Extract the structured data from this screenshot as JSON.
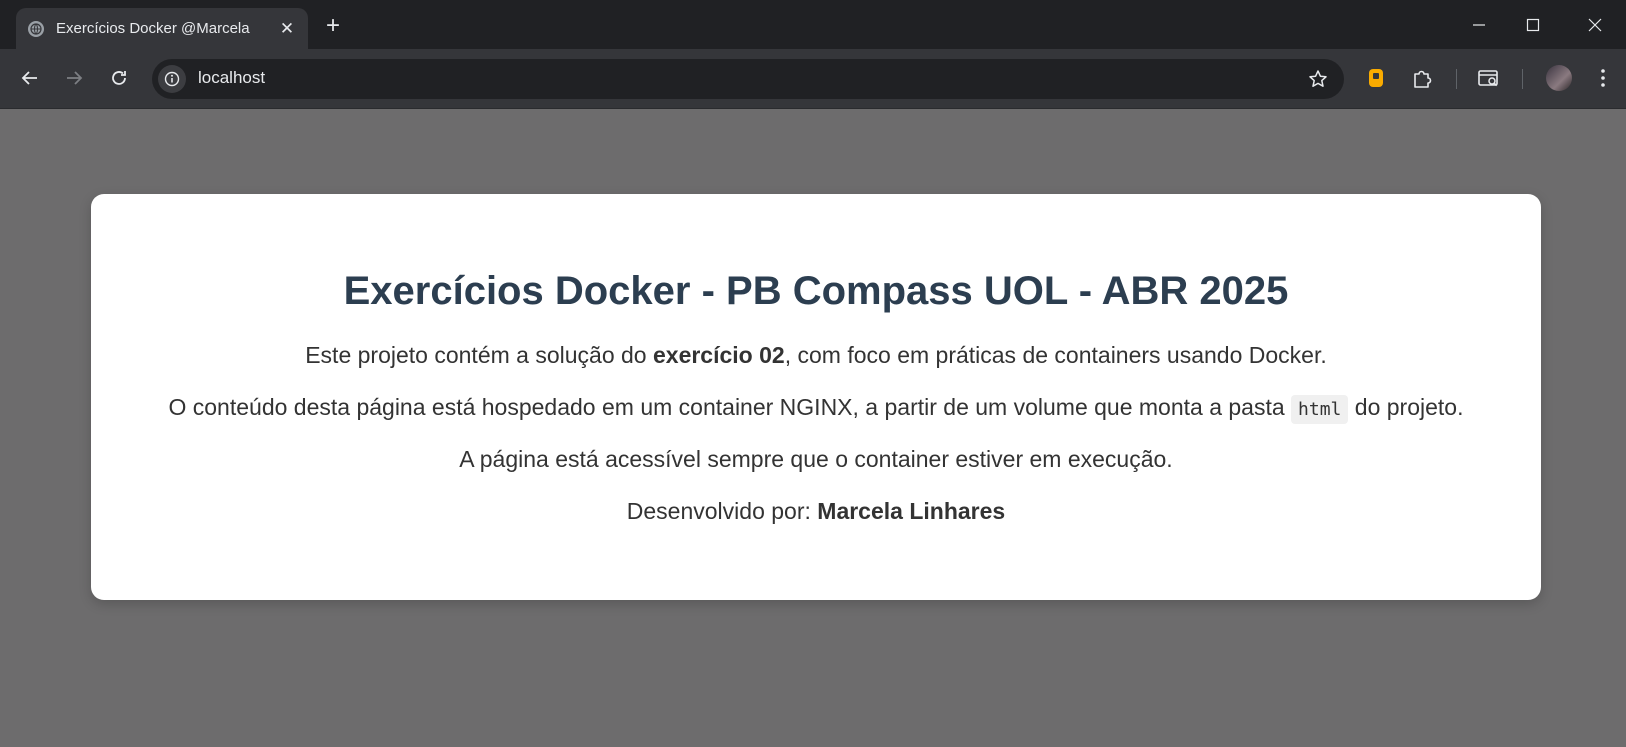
{
  "browser": {
    "tab_title": "Exercícios Docker @Marcela",
    "tab_close": "✕",
    "new_tab": "+",
    "url": "localhost",
    "window_controls": {
      "minimize": "minimize-icon",
      "maximize": "maximize-icon",
      "close": "close-icon"
    },
    "accent_color": "#f9ab00"
  },
  "page": {
    "title": "Exercícios Docker - PB Compass UOL - ABR 2025",
    "p1_pre": "Este projeto contém a solução do ",
    "p1_bold": "exercício 02",
    "p1_post": ", com foco em práticas de containers usando Docker.",
    "p2_pre": "O conteúdo desta página está hospedado em um container NGINX, a partir de um volume que monta a pasta ",
    "p2_code": "html",
    "p2_post": " do projeto.",
    "p3": "A página está acessível sempre que o container estiver em execução.",
    "p4_pre": "Desenvolvido por: ",
    "p4_bold": "Marcela Linhares"
  }
}
